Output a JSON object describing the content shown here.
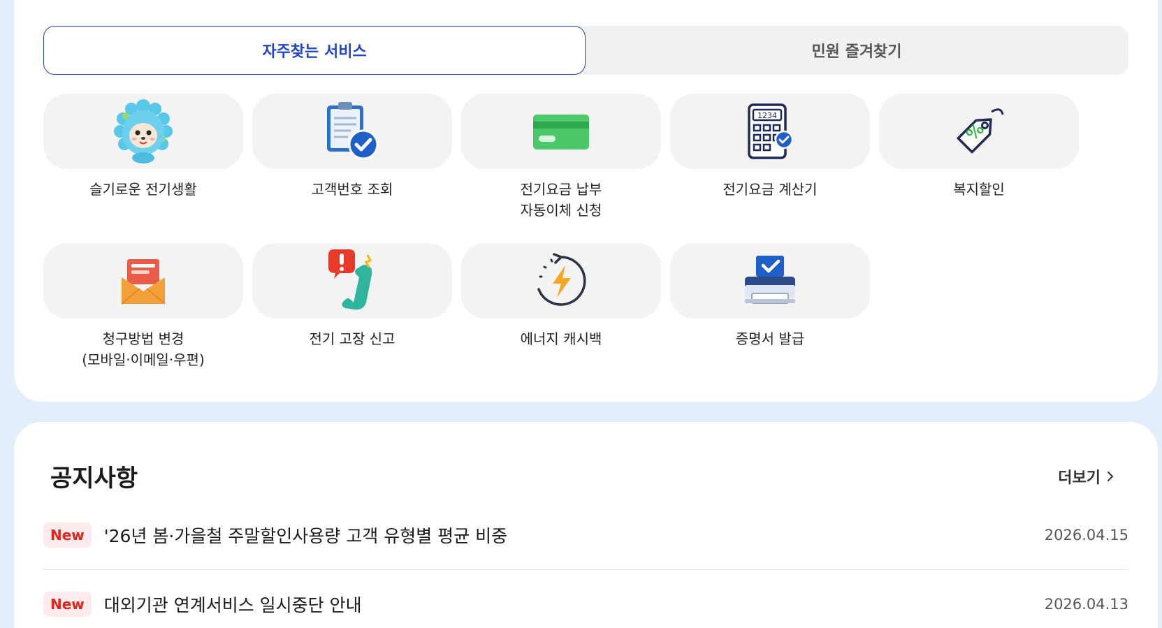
{
  "tabs": [
    {
      "label": "자주찾는 서비스",
      "active": true
    },
    {
      "label": "민원 즐겨찾기",
      "active": false
    }
  ],
  "services": [
    {
      "label": "슬기로운 전기생활",
      "icon": "hedgehog-mascot-icon"
    },
    {
      "label": "고객번호 조회",
      "icon": "clipboard-check-icon"
    },
    {
      "label": "전기요금 납부\n자동이체 신청",
      "icon": "credit-card-icon"
    },
    {
      "label": "전기요금 계산기",
      "icon": "calculator-icon"
    },
    {
      "label": "복지할인",
      "icon": "discount-tag-icon"
    },
    {
      "label": "청구방법 변경\n(모바일·이메일·우편)",
      "icon": "envelope-icon"
    },
    {
      "label": "전기 고장 신고",
      "icon": "phone-alert-icon"
    },
    {
      "label": "에너지 캐시백",
      "icon": "energy-cashback-icon"
    },
    {
      "label": "증명서 발급",
      "icon": "printer-check-icon"
    }
  ],
  "notice": {
    "title": "공지사항",
    "more_label": "더보기",
    "items": [
      {
        "badge": "New",
        "text": "'26년 봄·가을철 주말할인사용량 고객 유형별 평균 비중",
        "date": "2026.04.15"
      },
      {
        "badge": "New",
        "text": "대외기관 연계서비스 일시중단 안내",
        "date": "2026.04.13"
      }
    ]
  },
  "colors": {
    "accent": "#1f46c8",
    "badge_text": "#e0261c",
    "badge_bg": "#fdeceb",
    "page_bg": "#e3eefb"
  }
}
